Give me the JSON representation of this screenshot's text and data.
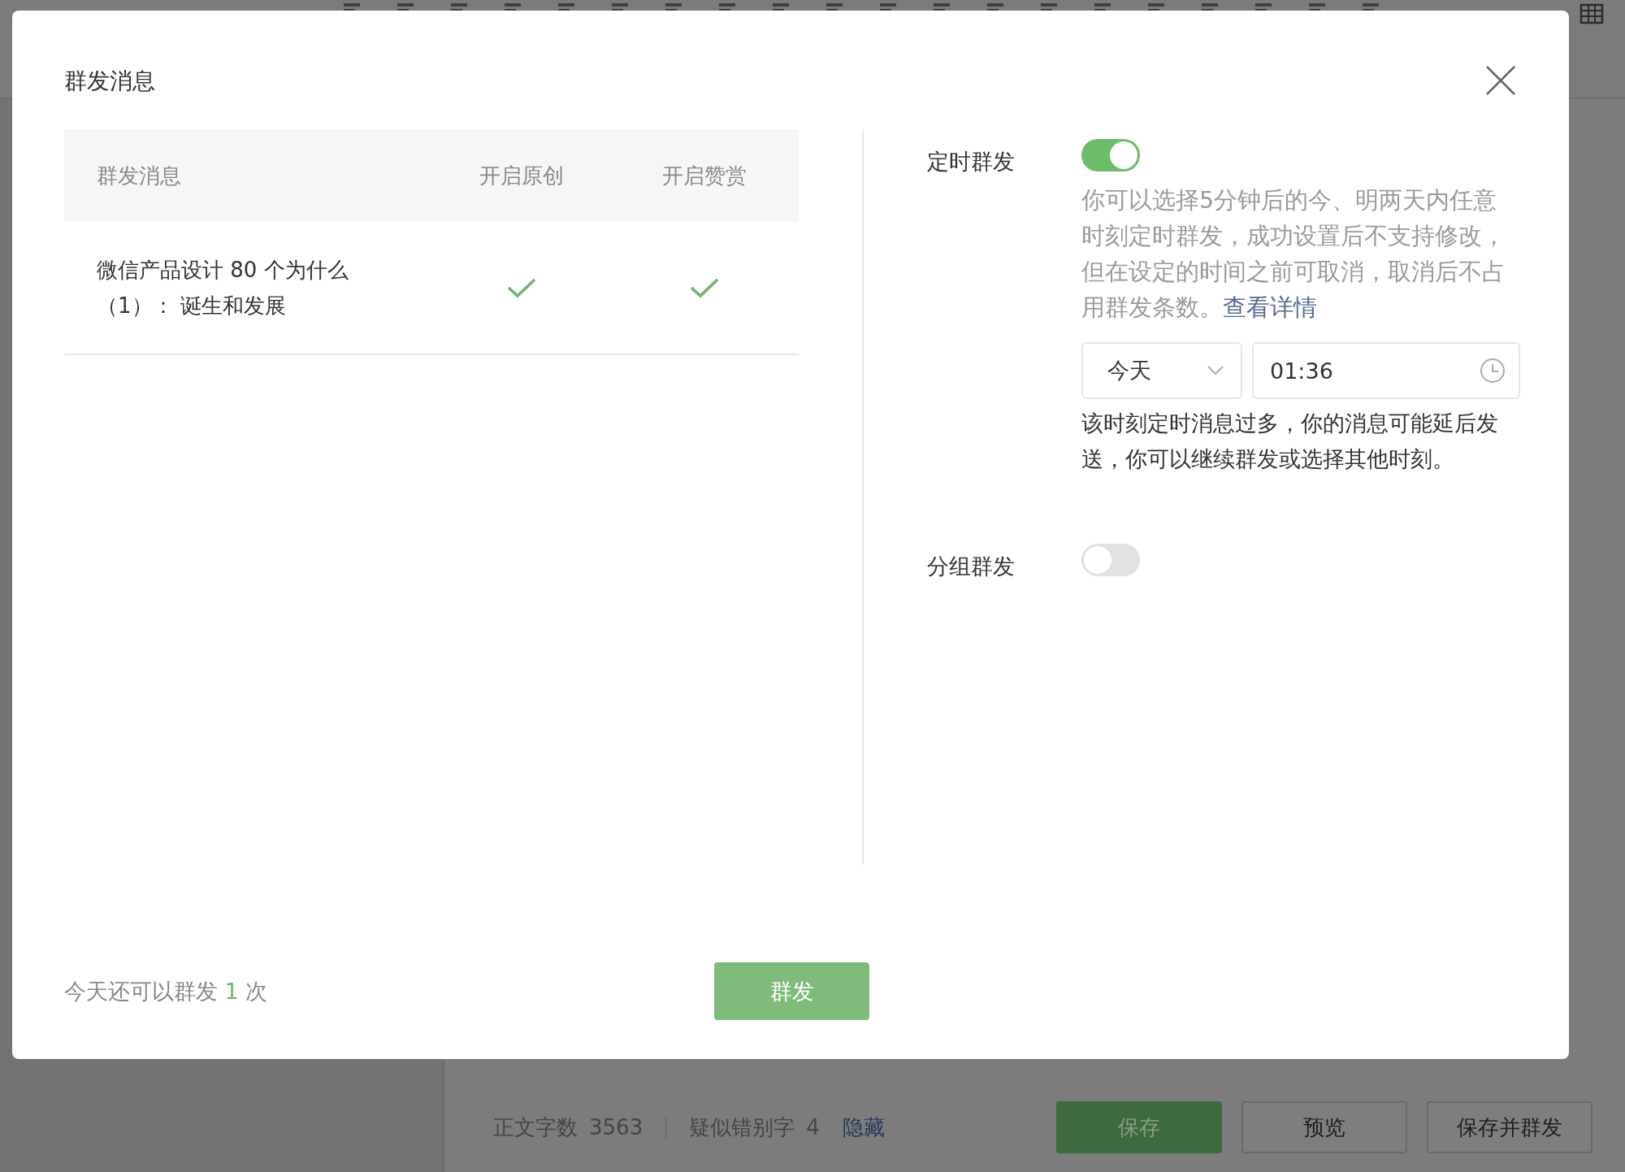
{
  "bottom_bar": {
    "word_count_label": "正文字数",
    "word_count": "3563",
    "typo_label": "疑似错别字",
    "typo_count": "4",
    "hide_link": "隐藏",
    "buttons": [
      {
        "label": "保存",
        "kind": "primary"
      },
      {
        "label": "预览",
        "kind": "default"
      },
      {
        "label": "保存并群发",
        "kind": "default"
      }
    ]
  },
  "dialog": {
    "title": "群发消息",
    "table": {
      "columns": [
        "群发消息",
        "开启原创",
        "开启赞赏"
      ],
      "rows": [
        {
          "title": "微信产品设计 80 个为什么（1）： 诞生和发展",
          "original": true,
          "reward": true
        }
      ]
    },
    "settings": [
      {
        "label": "定时群发",
        "on": true,
        "description": "你可以选择5分钟后的今、明两天内任意时刻定时群发，成功设置后不支持修改，但在设定的时间之前可取消，取消后不占用群发条数。",
        "link": "查看详情",
        "date": "今天",
        "time": "01:36",
        "warning": "该时刻定时消息过多，你的消息可能延后发送，你可以继续群发或选择其他时刻。"
      },
      {
        "label": "分组群发",
        "on": false
      }
    ],
    "footer": {
      "quota_prefix": "今天还可以群发",
      "quota_count": "1",
      "quota_suffix": "次",
      "send_button": "群发"
    }
  }
}
